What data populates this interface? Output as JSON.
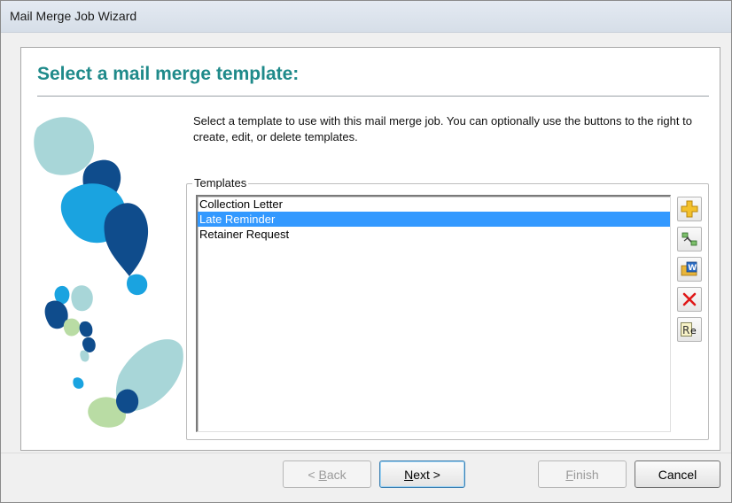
{
  "window": {
    "title": "Mail Merge Job Wizard"
  },
  "page": {
    "heading": "Select a mail merge template:",
    "description": "Select a template to use with this mail merge job. You can optionally use the buttons to the right to create, edit, or delete templates."
  },
  "templates": {
    "label": "Templates",
    "items": [
      "Collection Letter",
      "Late Reminder",
      "Retainer Request"
    ],
    "selected": "Late Reminder"
  },
  "side_buttons": [
    {
      "name": "add-template-button",
      "icon": "plus-icon"
    },
    {
      "name": "edit-template-button",
      "icon": "edit-fields-icon"
    },
    {
      "name": "open-word-template-button",
      "icon": "word-folder-icon"
    },
    {
      "name": "delete-template-button",
      "icon": "red-x-icon"
    },
    {
      "name": "rename-template-button",
      "icon": "rename-icon"
    }
  ],
  "footer": {
    "back": {
      "prefix": "< ",
      "accel": "B",
      "rest": "ack",
      "enabled": false
    },
    "next": {
      "accel": "N",
      "rest": "ext >",
      "enabled": true
    },
    "finish": {
      "accel": "F",
      "rest": "inish",
      "enabled": false
    },
    "cancel": {
      "label": "Cancel",
      "enabled": true
    }
  },
  "colors": {
    "heading": "#1f8a8a",
    "selection": "#3399ff",
    "art_dark_blue": "#0f4c8c",
    "art_mid_blue": "#1aa3e0",
    "art_light_teal": "#a8d6d8",
    "art_light_green": "#b9dca4"
  }
}
